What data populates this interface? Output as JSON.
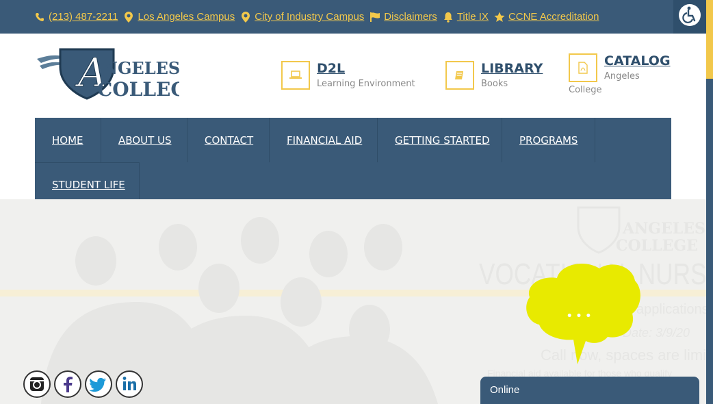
{
  "topbar": {
    "phone": "(213) 487-2211",
    "la_campus": "Los Angeles Campus",
    "industry_campus": "City of Industry Campus",
    "disclaimers": "Disclaimers",
    "title_ix": "Title IX",
    "ccne": "CCNE Accreditation"
  },
  "logo": {
    "line1": "NGELES",
    "line2": "COLLEGE",
    "letter": "A"
  },
  "quick_links": [
    {
      "title": "D2L",
      "sub": "Learning Environment",
      "icon": "laptop-icon"
    },
    {
      "title": "LIBRARY",
      "sub": "Books",
      "icon": "book-icon"
    },
    {
      "title": "CATALOG",
      "sub_line1": "Angeles",
      "sub_line2": "College",
      "icon": "pdf-file-icon"
    }
  ],
  "nav": {
    "items": [
      "HOME",
      "ABOUT US",
      "CONTACT",
      "FINANCIAL AID",
      "GETTING STARTED",
      "PROGRAMS",
      "STUDENT LIFE"
    ]
  },
  "hero": {
    "logo_line1": "ANGELES",
    "logo_line2": "COLLEGE",
    "headline": "VOCATIONAL NURSING",
    "line1": "applications",
    "line2": "Date: 3/9/20",
    "line3": "Call now, spaces are limited",
    "line4": "Financial aid available for those who qualify"
  },
  "chat": {
    "status": "Online",
    "dots": "• • •"
  },
  "social": [
    "instagram-icon",
    "facebook-icon",
    "twitter-icon",
    "linkedin-icon"
  ],
  "colors": {
    "navy": "#3a5a78",
    "gold": "#f2c84b",
    "chat_bubble": "#e8ea00"
  }
}
